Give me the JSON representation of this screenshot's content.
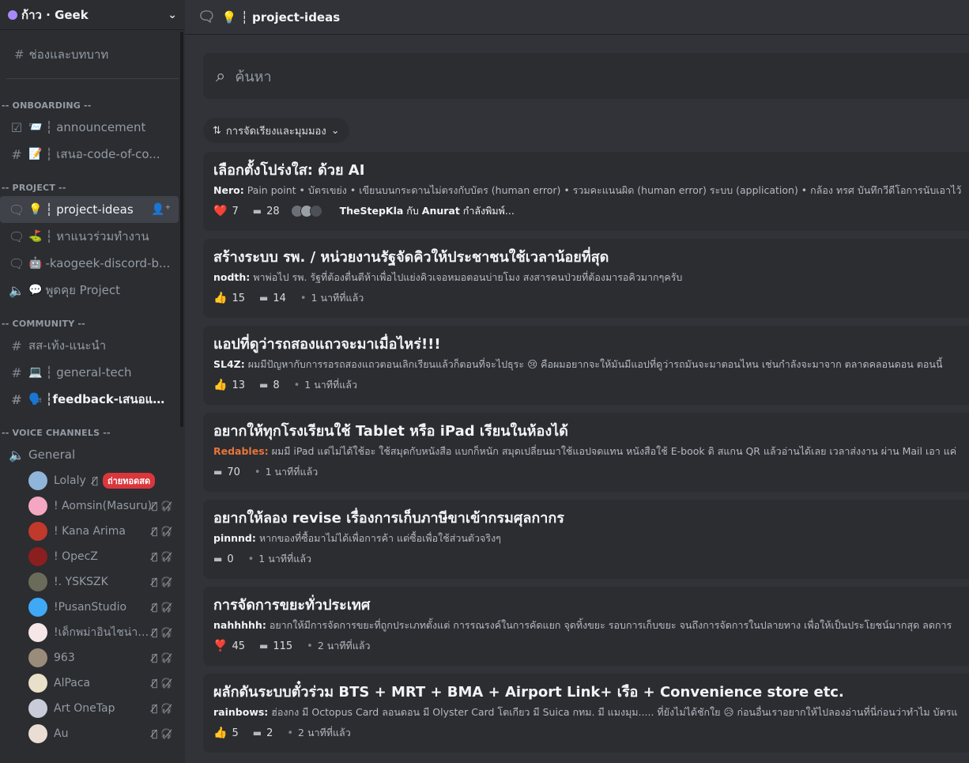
{
  "server": {
    "name": "ก้าว · Geek"
  },
  "sidebar": {
    "browse_label": "ช่องและบทบาท",
    "categories": [
      "-- ONBOARDING --",
      "-- PROJECT --",
      "-- COMMUNITY --",
      "-- VOICE CHANNELS --"
    ],
    "channels": [
      {
        "label": "┆ announcement",
        "icon": "📨"
      },
      {
        "label": "┆ เสนอ-code-of-co...",
        "icon": "📝"
      },
      {
        "label": "┆ project-ideas",
        "icon": "💡"
      },
      {
        "label": "┆ หาแนวร่วมทำงาน",
        "icon": "⛳"
      },
      {
        "label": "-kaogeek-discord-b...",
        "icon": "🤖"
      },
      {
        "label": "พูดคุย Project",
        "icon": "💬"
      },
      {
        "label": "สส-เท้ง-แนะนำ",
        "icon": ""
      },
      {
        "label": "┆ general-tech",
        "icon": "💻"
      },
      {
        "label": "┆feedback-เสนอแนะ...",
        "icon": "🗣️"
      },
      {
        "label": "General",
        "icon": ""
      }
    ],
    "voice_users": [
      {
        "name": "Lolaly",
        "badge": "ถ่ายทอดสด",
        "color": "#8fb6d8"
      },
      {
        "name": "! Aomsin(Masuru)",
        "color": "#f4a7c0"
      },
      {
        "name": "! Kana Arima",
        "color": "#c0392b"
      },
      {
        "name": "! OpecZ",
        "color": "#8b1e1e"
      },
      {
        "name": "!. YSKSZK",
        "color": "#6b6b5a"
      },
      {
        "name": "!PusanStudio",
        "color": "#3fa9f5"
      },
      {
        "name": "!เด็กพม่าอินไชน่ากำลังซึ้...",
        "color": "#f5e6e8"
      },
      {
        "name": "963",
        "color": "#9a8c7a"
      },
      {
        "name": "AlPaca",
        "color": "#e8e0c8"
      },
      {
        "name": "Art OneTap",
        "color": "#c9ccd8"
      },
      {
        "name": "Au",
        "color": "#e9ddd4"
      }
    ]
  },
  "topbar": {
    "channel": "💡 ┆ project-ideas"
  },
  "search": {
    "placeholder": "ค้นหา"
  },
  "sort": {
    "label": "การจัดเรียงและมุมมอง"
  },
  "posts": [
    {
      "title": "เลือกตั้งโปร่งใส: ด้วย AI",
      "author": "Nero:",
      "snippet": "Pain point • บัตรเขย่ง  • เขียนบนกระดานไม่ตรงกับบัตร (human error)  • รวมคะแนนผิด (human error)     ระบบ (application) • กล้อง ทรศ บันทึกวีดีโอการนับเอาไว้",
      "reaction": "❤️",
      "reactions": "7",
      "comments": "28",
      "typing_users": "TheStepKla",
      "typing_join": " กับ ",
      "typing_user2": "Anurat",
      "typing_suffix": " กำลังพิมพ์..."
    },
    {
      "title": "สร้างระบบ รพ. / หน่วยงานรัฐจัดคิวให้ประชาชนใช้เวลาน้อยที่สุด",
      "author": "nodth:",
      "snippet": "พาพ่อไป รพ. รัฐที่ต้องตื่นตีห้าเพื่อไปแย่งคิวเจอหมอตอนบ่ายโมง สงสารคนป่วยที่ต้องมารอคิวมากๆครับ",
      "reaction": "👍",
      "reactions": "15",
      "comments": "14",
      "time": "1 นาทีที่แล้ว"
    },
    {
      "title": "แอปที่ดูว่ารถสองแถวจะมาเมื่อไหร่!!!",
      "author": "SL4Z:",
      "snippet": "ผมมีปัญหากับการรอรถสองแถวตอนเลิกเรียนแล้วก็ตอนที่จะไปธุระ 😢 คือผมอยากจะให้มันมีแอปที่ดูว่ารถมันจะมาตอนไหน เช่นกำลังจะมาจาก ตลาดคลอนดอน ตอนนี้",
      "reaction": "👍",
      "reactions": "13",
      "comments": "8",
      "time": "1 นาทีที่แล้ว"
    },
    {
      "title": "อยากให้ทุกโรงเรียนใช้ Tablet หรือ iPad เรียนในห้องได้",
      "author": "Redables:",
      "author_orange": true,
      "snippet": "ผมมี iPad แต่ไม่ได้ใช้อะ ใช้สมุดกับหนังสือ แบกก็หนัก สมุดเปลี่ยนมาใช้แอปจดแทน หนังสือใช้ E-book ดิ สแกน QR แล้วอ่านได้เลย เวลาส่งงาน ผ่าน Mail เอา แค่",
      "comments": "70",
      "time": "1 นาทีที่แล้ว"
    },
    {
      "title": "อยากให้ลอง revise เรื่องการเก็บภาษีขาเข้ากรมศุลกากร",
      "author": "pinnnd:",
      "snippet": "หากของที่ซื้อมาไม่ได้เพื่อการค้า แต่ซื้อเพื่อใช้ส่วนตัวจริงๆ",
      "comments": "0",
      "time": "1 นาทีที่แล้ว"
    },
    {
      "title": "การจัดการขยะทั่วประเทศ",
      "author": "nahhhhh:",
      "snippet": "อยากให้มีการจัดการขยะที่ถูกประเภทตั้งแต่ การรณรงค์ในการคัดแยก จุดทิ้งขยะ รอบการเก็บขยะ จนถึงการจัดการในปลายทาง เพื่อให้เป็นประโยชน์มากสุด ลดการ",
      "reaction": "❣️",
      "reactions": "45",
      "comments": "115",
      "time": "2 นาทีที่แล้ว"
    },
    {
      "title": "ผลักดันระบบตั๋วร่วม BTS + MRT + BMA + Airport Link+ เรือ + Convenience store etc.",
      "author": "rainbows:",
      "snippet": "ฮ่องกง มี Octopus Card ลอนดอน มี Olyster Card โตเกียว มี Suica กทม. มี แมงมุม..... ที่ยังไม่ได้ชักใย 😥 ก่อนอื่นเราอยากให้ไปลองอ่านที่นี่ก่อนว่าทำไม บัตรแ",
      "reaction": "👍",
      "reactions": "5",
      "comments": "2",
      "time": "2 นาทีที่แล้ว"
    }
  ]
}
